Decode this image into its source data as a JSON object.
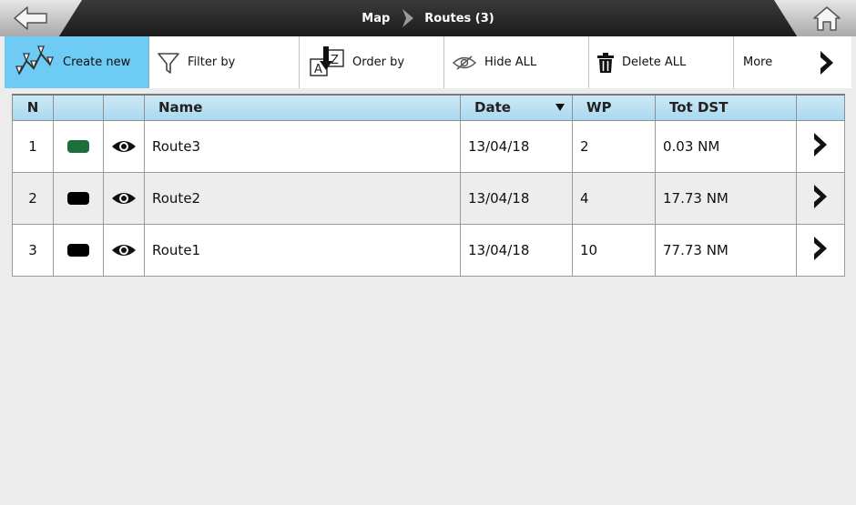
{
  "breadcrumb": {
    "map": "Map",
    "routes": "Routes (3)"
  },
  "toolbar": {
    "create_new": "Create new",
    "filter_by": "Filter by",
    "order_by": "Order by",
    "hide_all": "Hide ALL",
    "delete_all": "Delete ALL",
    "more": "More"
  },
  "table": {
    "headers": {
      "n": "N",
      "color": "",
      "visibility": "",
      "name": "Name",
      "date": "Date",
      "wp": "WP",
      "tot_dst": "Tot DST"
    },
    "rows": [
      {
        "n": "1",
        "color": "#1e6e3b",
        "name": "Route3",
        "date": "13/04/18",
        "wp": "2",
        "tot_dst": "0.03 NM"
      },
      {
        "n": "2",
        "color": "#000000",
        "name": "Route2",
        "date": "13/04/18",
        "wp": "4",
        "tot_dst": "17.73 NM"
      },
      {
        "n": "3",
        "color": "#000000",
        "name": "Route1",
        "date": "13/04/18",
        "wp": "10",
        "tot_dst": "77.73 NM"
      }
    ]
  },
  "colors": {
    "accent": "#6dcbf4",
    "header_bar": "#1c1c1c"
  },
  "icons": {
    "back": "back-arrow-icon",
    "home": "home-icon",
    "create": "route-nodes-icon",
    "filter": "funnel-icon",
    "order": "sort-az-icon",
    "hide": "eye-slash-icon",
    "delete": "trash-icon",
    "more": "chevron-right-icon",
    "visible": "eye-icon",
    "sort_desc": "triangle-down-icon",
    "row_open": "chevron-right-icon"
  }
}
